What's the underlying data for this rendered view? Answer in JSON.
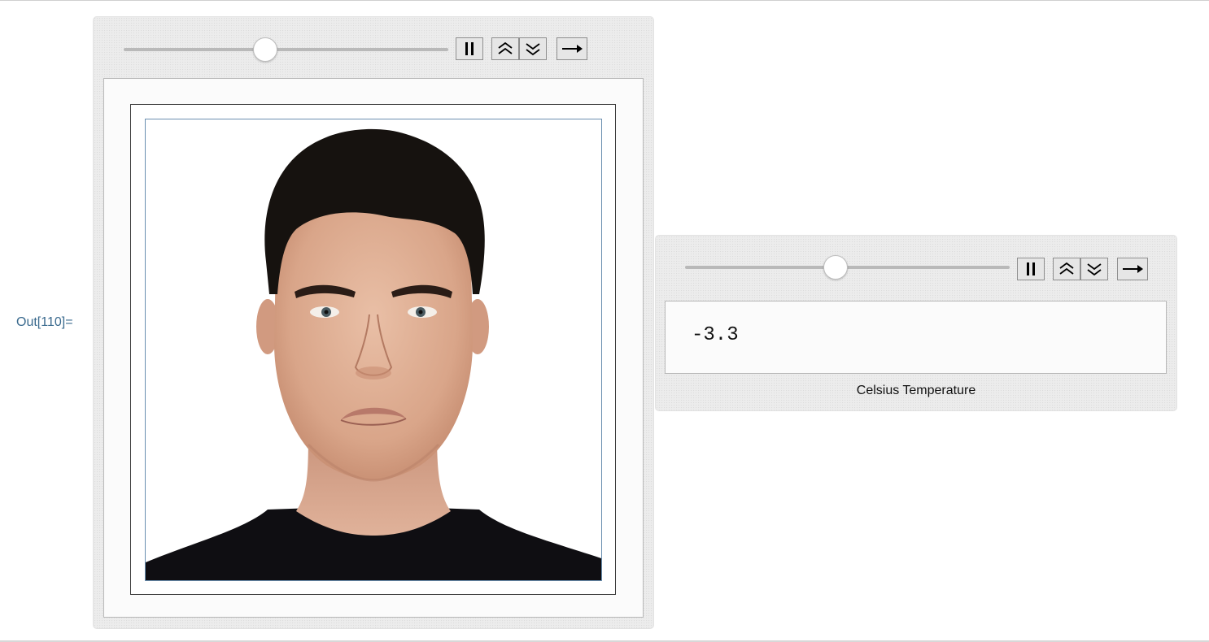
{
  "output_label": "Out[110]=",
  "manipulate_image": {
    "slider": {
      "position_fraction": 0.435,
      "min_label": "",
      "max_label": ""
    },
    "controls": [
      {
        "name": "pause-button",
        "icon": "pause-icon"
      },
      {
        "name": "faster-button",
        "icon": "double-chevron-up-icon"
      },
      {
        "name": "slower-button",
        "icon": "double-chevron-down-icon"
      },
      {
        "name": "direction-button",
        "icon": "arrow-right-icon"
      }
    ],
    "image": {
      "subject": "portrait-face",
      "expression": "frown"
    }
  },
  "manipulate_value": {
    "slider": {
      "position_fraction": 0.463
    },
    "controls": [
      {
        "name": "pause-button",
        "icon": "pause-icon"
      },
      {
        "name": "faster-button",
        "icon": "double-chevron-up-icon"
      },
      {
        "name": "slower-button",
        "icon": "double-chevron-down-icon"
      },
      {
        "name": "direction-button",
        "icon": "arrow-right-icon"
      }
    ],
    "value": "-3.3",
    "caption": "Celsius Temperature"
  },
  "colors": {
    "out_label": "#3a6a8e",
    "panel_bg": "#ececec",
    "image_border": "#6a8fb0"
  }
}
